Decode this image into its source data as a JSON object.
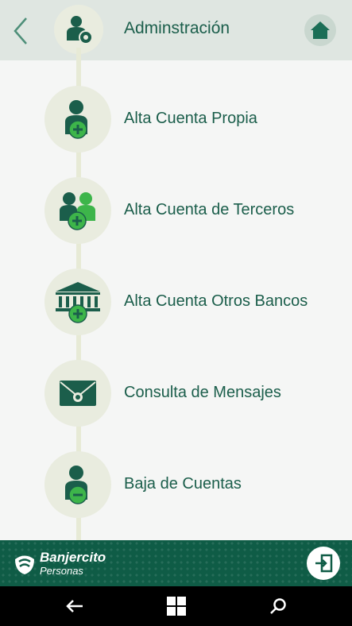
{
  "header": {
    "title": "Adminstración",
    "back_icon": "chevron-left-icon",
    "title_icon": "admin-user-gear-icon",
    "home_icon": "home-icon"
  },
  "menu": {
    "items": [
      {
        "label": "Alta Cuenta Propia",
        "icon": "user-add-icon"
      },
      {
        "label": "Alta Cuenta de Terceros",
        "icon": "users-add-icon"
      },
      {
        "label": "Alta Cuenta Otros Bancos",
        "icon": "bank-add-icon"
      },
      {
        "label": "Consulta de Mensajes",
        "icon": "envelope-icon"
      },
      {
        "label": "Baja de Cuentas",
        "icon": "user-remove-icon"
      }
    ]
  },
  "footer": {
    "brand_name": "Banjercito",
    "brand_sub": "Personas",
    "exit_icon": "logout-icon"
  },
  "system_nav": {
    "back_icon": "back-arrow-icon",
    "start_icon": "windows-start-icon",
    "search_icon": "search-icon"
  },
  "colors": {
    "primary": "#1b5e4b",
    "accent_green": "#3db54a",
    "header_bg": "#dfe6e1",
    "circle_bg": "#e9ecdf",
    "footer_bg": "#0f5c46"
  }
}
